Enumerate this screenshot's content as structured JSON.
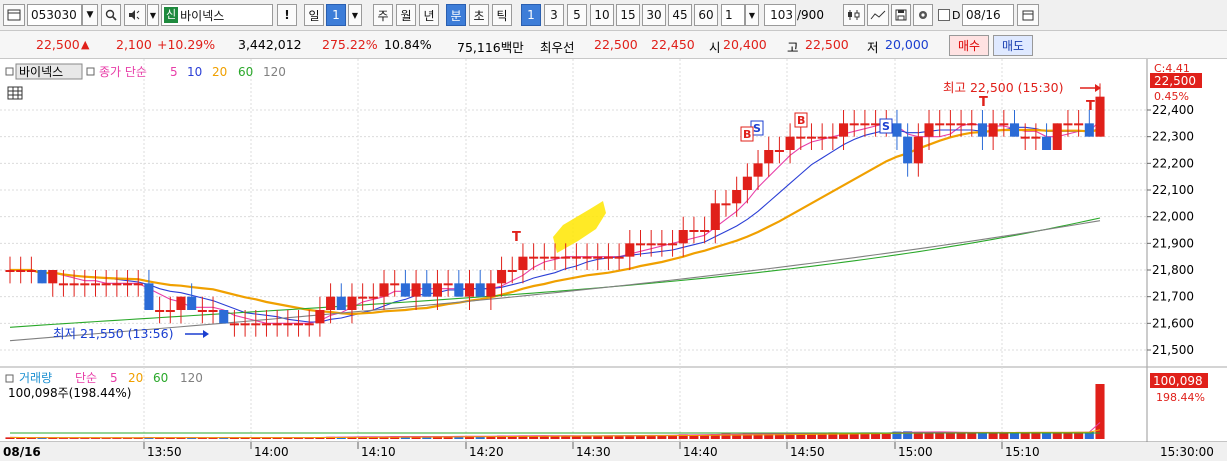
{
  "toolbar": {
    "code": "053030",
    "name_tag": "신",
    "name": "바이넥스",
    "alert": "!",
    "period_day": "일",
    "period_num": "1",
    "period_week": "주",
    "period_month": "월",
    "period_year": "년",
    "period_min": "분",
    "period_sec": "초",
    "period_tick": "틱",
    "intervals": [
      "1",
      "3",
      "5",
      "10",
      "15",
      "30",
      "45",
      "60"
    ],
    "interval_value": "1",
    "count_value": "103",
    "count_total": "/900",
    "d_label": "D",
    "date_value": "08/16"
  },
  "quote": {
    "price": "22,500",
    "change_arrow": "▲",
    "change": "2,100",
    "change_pct": "+10.29%",
    "volume": "3,442,012",
    "vol_ratio": "275.22%",
    "turnover": "10.84%",
    "amount": "75,116백만",
    "best_label": "최우선",
    "ask": "22,500",
    "bid": "22,450",
    "open_label": "시",
    "open": "20,400",
    "high_label": "고",
    "high": "22,500",
    "low_label": "저",
    "low": "20,000",
    "buy": "매수",
    "sell": "매도"
  },
  "price_panel": {
    "stock_label": "바이넥스",
    "ma_label": "종가 단순",
    "ma_periods": [
      "5",
      "10",
      "20",
      "60",
      "120"
    ],
    "ma_colors": [
      "#e83ea8",
      "#2b3fd6",
      "#f0a000",
      "#2aa82a",
      "#808080"
    ],
    "high_annot": "최고 22,500 (15:30)",
    "low_annot": "최저 21,550 (13:56)",
    "current_price_box": "22,500",
    "current_pct_box": "0.45%",
    "right_corner_label": "C:4.41",
    "y_ticks": [
      "22,400",
      "22,300",
      "22,200",
      "22,100",
      "22,000",
      "21,900",
      "21,800",
      "21,700",
      "21,600",
      "21,500"
    ],
    "markers": [
      "S",
      "B",
      "B",
      "S"
    ],
    "t_markers": [
      "T",
      "T",
      "T"
    ]
  },
  "volume_panel": {
    "label": "거래량",
    "ma_label": "단순",
    "ma_periods": [
      "5",
      "20",
      "60",
      "120"
    ],
    "ma_colors": [
      "#e83ea8",
      "#f0a000",
      "#2aa82a",
      "#808080"
    ],
    "info": "100,098주(198.44%)",
    "current_box": "100,098",
    "current_pct": "198.44%"
  },
  "x_axis": {
    "date": "08/16",
    "ticks": [
      "13:50",
      "14:00",
      "14:10",
      "14:20",
      "14:30",
      "14:40",
      "14:50",
      "15:00",
      "15:10"
    ],
    "end_time": "15:30:00"
  },
  "colors": {
    "up": "#e0201a",
    "down": "#2b6bd6",
    "highlight": "#ffe600"
  },
  "chart_data": {
    "type": "candlestick",
    "unit": "KRW",
    "ylim": [
      21450,
      22450
    ],
    "y_ticks": [
      22400,
      22300,
      22200,
      22100,
      22000,
      21900,
      21800,
      21700,
      21600,
      21500
    ],
    "candles": [
      [
        21800,
        21850,
        21750,
        21800
      ],
      [
        21800,
        21850,
        21750,
        21800
      ],
      [
        21800,
        21850,
        21750,
        21800
      ],
      [
        21800,
        21800,
        21750,
        21750
      ],
      [
        21750,
        21800,
        21700,
        21800
      ],
      [
        21750,
        21800,
        21700,
        21750
      ],
      [
        21750,
        21800,
        21700,
        21750
      ],
      [
        21750,
        21800,
        21700,
        21750
      ],
      [
        21750,
        21800,
        21700,
        21750
      ],
      [
        21750,
        21800,
        21700,
        21750
      ],
      [
        21750,
        21800,
        21700,
        21750
      ],
      [
        21750,
        21800,
        21700,
        21750
      ],
      [
        21750,
        21800,
        21700,
        21750
      ],
      [
        21750,
        21800,
        21700,
        21650
      ],
      [
        21650,
        21700,
        21600,
        21650
      ],
      [
        21650,
        21700,
        21600,
        21650
      ],
      [
        21650,
        21700,
        21600,
        21700
      ],
      [
        21700,
        21750,
        21650,
        21650
      ],
      [
        21650,
        21700,
        21600,
        21650
      ],
      [
        21650,
        21700,
        21600,
        21650
      ],
      [
        21650,
        21650,
        21600,
        21600
      ],
      [
        21600,
        21650,
        21550,
        21600
      ],
      [
        21600,
        21650,
        21550,
        21600
      ],
      [
        21600,
        21650,
        21550,
        21600
      ],
      [
        21600,
        21650,
        21550,
        21600
      ],
      [
        21600,
        21650,
        21550,
        21600
      ],
      [
        21600,
        21650,
        21550,
        21600
      ],
      [
        21600,
        21650,
        21550,
        21600
      ],
      [
        21600,
        21650,
        21550,
        21600
      ],
      [
        21600,
        21700,
        21550,
        21650
      ],
      [
        21650,
        21750,
        21600,
        21700
      ],
      [
        21700,
        21750,
        21650,
        21650
      ],
      [
        21650,
        21750,
        21600,
        21700
      ],
      [
        21700,
        21750,
        21650,
        21700
      ],
      [
        21700,
        21750,
        21650,
        21700
      ],
      [
        21700,
        21800,
        21650,
        21750
      ],
      [
        21750,
        21800,
        21700,
        21750
      ],
      [
        21750,
        21800,
        21700,
        21700
      ],
      [
        21700,
        21800,
        21650,
        21750
      ],
      [
        21750,
        21800,
        21700,
        21700
      ],
      [
        21700,
        21800,
        21650,
        21750
      ],
      [
        21750,
        21800,
        21700,
        21750
      ],
      [
        21750,
        21800,
        21700,
        21700
      ],
      [
        21700,
        21800,
        21650,
        21750
      ],
      [
        21750,
        21800,
        21700,
        21700
      ],
      [
        21700,
        21800,
        21650,
        21750
      ],
      [
        21750,
        21850,
        21700,
        21800
      ],
      [
        21800,
        21850,
        21750,
        21800
      ],
      [
        21800,
        21900,
        21750,
        21850
      ],
      [
        21850,
        21900,
        21800,
        21850
      ],
      [
        21850,
        21900,
        21800,
        21850
      ],
      [
        21850,
        21900,
        21800,
        21850
      ],
      [
        21850,
        21900,
        21800,
        21850
      ],
      [
        21850,
        21900,
        21800,
        21850
      ],
      [
        21850,
        21900,
        21800,
        21850
      ],
      [
        21850,
        21900,
        21800,
        21850
      ],
      [
        21850,
        21900,
        21800,
        21850
      ],
      [
        21850,
        21900,
        21800,
        21850
      ],
      [
        21850,
        21950,
        21800,
        21900
      ],
      [
        21900,
        21950,
        21850,
        21900
      ],
      [
        21900,
        21950,
        21850,
        21900
      ],
      [
        21900,
        21950,
        21850,
        21900
      ],
      [
        21900,
        21950,
        21850,
        21900
      ],
      [
        21900,
        22000,
        21850,
        21950
      ],
      [
        21950,
        22000,
        21900,
        21950
      ],
      [
        21950,
        22000,
        21900,
        21950
      ],
      [
        21950,
        22100,
        21900,
        22050
      ],
      [
        22050,
        22100,
        22000,
        22050
      ],
      [
        22050,
        22150,
        22000,
        22100
      ],
      [
        22100,
        22200,
        22050,
        22150
      ],
      [
        22150,
        22250,
        22100,
        22200
      ],
      [
        22200,
        22300,
        22150,
        22250
      ],
      [
        22250,
        22300,
        22200,
        22250
      ],
      [
        22250,
        22350,
        22200,
        22300
      ],
      [
        22300,
        22350,
        22250,
        22300
      ],
      [
        22300,
        22350,
        22250,
        22300
      ],
      [
        22300,
        22350,
        22250,
        22300
      ],
      [
        22300,
        22350,
        22250,
        22300
      ],
      [
        22300,
        22400,
        22250,
        22350
      ],
      [
        22350,
        22400,
        22300,
        22350
      ],
      [
        22350,
        22400,
        22300,
        22350
      ],
      [
        22350,
        22400,
        22300,
        22350
      ],
      [
        22350,
        22400,
        22300,
        22350
      ],
      [
        22350,
        22400,
        22250,
        22300
      ],
      [
        22300,
        22350,
        22150,
        22200
      ],
      [
        22200,
        22350,
        22150,
        22300
      ],
      [
        22300,
        22400,
        22250,
        22350
      ],
      [
        22350,
        22400,
        22300,
        22350
      ],
      [
        22350,
        22400,
        22300,
        22350
      ],
      [
        22350,
        22400,
        22300,
        22350
      ],
      [
        22350,
        22400,
        22300,
        22350
      ],
      [
        22350,
        22400,
        22250,
        22300
      ],
      [
        22300,
        22400,
        22250,
        22350
      ],
      [
        22350,
        22400,
        22300,
        22350
      ],
      [
        22350,
        22400,
        22300,
        22300
      ],
      [
        22300,
        22350,
        22250,
        22300
      ],
      [
        22300,
        22350,
        22250,
        22300
      ],
      [
        22300,
        22350,
        22250,
        22250
      ],
      [
        22250,
        22350,
        22250,
        22350
      ],
      [
        22350,
        22400,
        22300,
        22350
      ],
      [
        22350,
        22400,
        22300,
        22350
      ],
      [
        22350,
        22400,
        22300,
        22300
      ],
      [
        22300,
        22500,
        22300,
        22450
      ]
    ],
    "volume_ylim": [
      0,
      100098
    ],
    "volume": [
      3000,
      2500,
      2000,
      2200,
      2400,
      2600,
      2300,
      2200,
      2400,
      2100,
      2600,
      2300,
      2200,
      3000,
      2500,
      2400,
      2600,
      2300,
      2700,
      2400,
      2500,
      3200,
      2800,
      2500,
      2400,
      2600,
      2800,
      2500,
      2700,
      3500,
      4000,
      3800,
      4200,
      4500,
      4000,
      4300,
      5200,
      4600,
      4100,
      4200,
      4800,
      5000,
      5500,
      5200,
      4800,
      5000,
      6200,
      5800,
      6500,
      6000,
      5700,
      6100,
      6300,
      5900,
      5800,
      6000,
      6400,
      6200,
      7000,
      6800,
      6600,
      6900,
      7200,
      8500,
      7900,
      8200,
      9000,
      9800,
      8500,
      10000,
      9500,
      9200,
      10500,
      9800,
      10200,
      9600,
      10400,
      12000,
      10800,
      11500,
      11000,
      10600,
      11200,
      13500,
      14000,
      13000,
      12500,
      12000,
      11800,
      12200,
      11600,
      12400,
      11900,
      12100,
      11700,
      12300,
      12000,
      11800,
      12500,
      12200,
      12800,
      13000,
      100098
    ]
  }
}
